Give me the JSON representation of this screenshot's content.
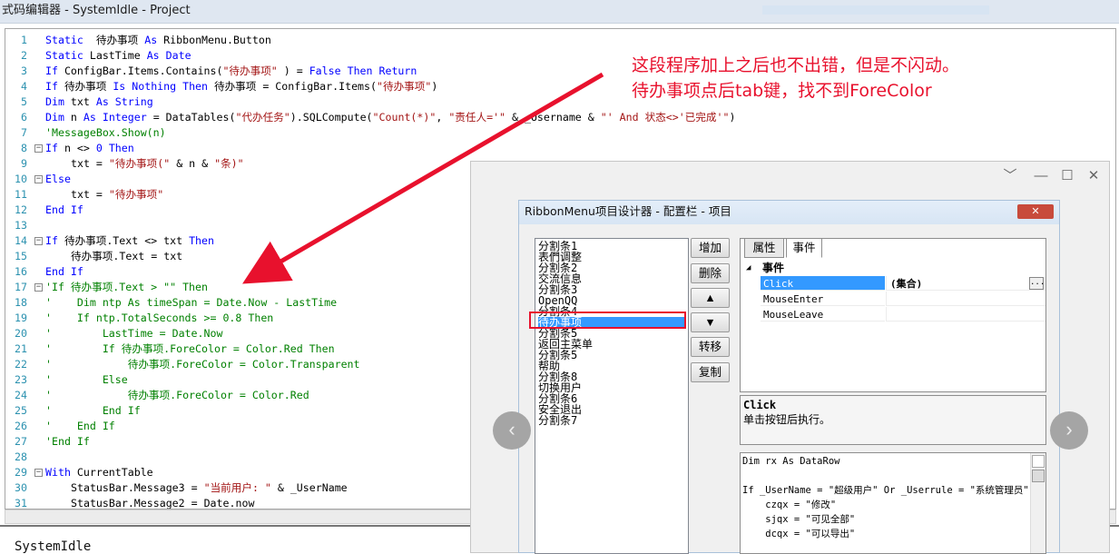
{
  "window": {
    "title": "式码编辑器 - SystemIdle - Project"
  },
  "code_lines": [
    {
      "n": "1",
      "segs": [
        [
          "kw",
          "Static"
        ],
        [
          "",
          "  待办事项 "
        ],
        [
          "kw",
          "As"
        ],
        [
          "",
          " RibbonMenu.Button"
        ]
      ]
    },
    {
      "n": "2",
      "segs": [
        [
          "kw",
          "Static"
        ],
        [
          "",
          " LastTime "
        ],
        [
          "kw",
          "As"
        ],
        [
          " kw",
          " Date"
        ]
      ]
    },
    {
      "n": "3",
      "segs": [
        [
          "kw",
          "If"
        ],
        [
          "",
          " ConfigBar.Items.Contains("
        ],
        [
          "str",
          "\"待办事项\""
        ],
        [
          "",
          " ) = "
        ],
        [
          "kw",
          "False Then Return"
        ]
      ]
    },
    {
      "n": "4",
      "segs": [
        [
          "kw",
          "If"
        ],
        [
          "",
          " 待办事项 "
        ],
        [
          "kw",
          "Is Nothing Then"
        ],
        [
          "",
          " 待办事项 = ConfigBar.Items("
        ],
        [
          "str",
          "\"待办事项\""
        ],
        [
          "",
          ")"
        ]
      ]
    },
    {
      "n": "5",
      "segs": [
        [
          "kw",
          "Dim"
        ],
        [
          "",
          " txt "
        ],
        [
          "kw",
          "As String"
        ]
      ]
    },
    {
      "n": "6",
      "segs": [
        [
          "kw",
          "Dim"
        ],
        [
          "",
          " n "
        ],
        [
          "kw",
          "As Integer"
        ],
        [
          "",
          " = DataTables("
        ],
        [
          "str",
          "\"代办任务\""
        ],
        [
          "",
          ").SQLCompute("
        ],
        [
          "str",
          "\"Count(*)\""
        ],
        [
          "",
          ", "
        ],
        [
          "str",
          "\"责任人='\""
        ],
        [
          "",
          " & _Username & "
        ],
        [
          "str",
          "\"' And 状态<>'已完成'\""
        ],
        [
          "",
          ")"
        ]
      ]
    },
    {
      "n": "7",
      "segs": [
        [
          "cm",
          "'MessageBox.Show(n)"
        ]
      ]
    },
    {
      "n": "8",
      "fold": "−",
      "segs": [
        [
          "kw",
          "If"
        ],
        [
          "",
          " n <> "
        ],
        [
          "kw",
          "0"
        ],
        [
          " kw",
          " Then"
        ]
      ]
    },
    {
      "n": "9",
      "indent": 2,
      "segs": [
        [
          "",
          "txt = "
        ],
        [
          "str",
          "\"待办事项(\""
        ],
        [
          "",
          " & n & "
        ],
        [
          "str",
          "\"条)\""
        ]
      ]
    },
    {
      "n": "10",
      "fold": "−",
      "segs": [
        [
          "kw",
          "Else"
        ]
      ]
    },
    {
      "n": "11",
      "indent": 2,
      "segs": [
        [
          "",
          "txt = "
        ],
        [
          "str",
          "\"待办事项\""
        ]
      ]
    },
    {
      "n": "12",
      "segs": [
        [
          "kw",
          "End If"
        ]
      ]
    },
    {
      "n": "13",
      "segs": []
    },
    {
      "n": "14",
      "fold": "−",
      "segs": [
        [
          "kw",
          "If"
        ],
        [
          "",
          " 待办事项.Text <> txt "
        ],
        [
          "kw",
          "Then"
        ]
      ]
    },
    {
      "n": "15",
      "indent": 2,
      "segs": [
        [
          "",
          "待办事项.Text = txt"
        ]
      ]
    },
    {
      "n": "16",
      "segs": [
        [
          "kw",
          "End If"
        ]
      ]
    },
    {
      "n": "17",
      "fold": "−",
      "segs": [
        [
          "cm",
          "'If 待办事项.Text > \"\" Then"
        ]
      ]
    },
    {
      "n": "18",
      "segs": [
        [
          "cm",
          "'    Dim ntp As timeSpan = Date.Now - LastTime"
        ]
      ]
    },
    {
      "n": "19",
      "segs": [
        [
          "cm",
          "'    If ntp.TotalSeconds >= 0.8 Then"
        ]
      ]
    },
    {
      "n": "20",
      "segs": [
        [
          "cm",
          "'        LastTime = Date.Now"
        ]
      ]
    },
    {
      "n": "21",
      "segs": [
        [
          "cm",
          "'        If 待办事项.ForeColor = Color.Red Then"
        ]
      ]
    },
    {
      "n": "22",
      "segs": [
        [
          "cm",
          "'            待办事项.ForeColor = Color.Transparent"
        ]
      ]
    },
    {
      "n": "23",
      "segs": [
        [
          "cm",
          "'        Else"
        ]
      ]
    },
    {
      "n": "24",
      "segs": [
        [
          "cm",
          "'            待办事项.ForeColor = Color.Red"
        ]
      ]
    },
    {
      "n": "25",
      "segs": [
        [
          "cm",
          "'        End If"
        ]
      ]
    },
    {
      "n": "26",
      "segs": [
        [
          "cm",
          "'    End If"
        ]
      ]
    },
    {
      "n": "27",
      "segs": [
        [
          "cm",
          "'End If"
        ]
      ]
    },
    {
      "n": "28",
      "segs": []
    },
    {
      "n": "29",
      "fold": "−",
      "segs": [
        [
          "kw",
          "With"
        ],
        [
          "",
          " CurrentTable"
        ]
      ]
    },
    {
      "n": "30",
      "indent": 2,
      "segs": [
        [
          "",
          "StatusBar.Message3 = "
        ],
        [
          "str",
          "\"当前用户: \""
        ],
        [
          "",
          " & _UserName"
        ]
      ]
    },
    {
      "n": "31",
      "indent": 2,
      "segs": [
        [
          "",
          "StatusBar.Message2 = Date.now"
        ]
      ]
    }
  ],
  "bottom_text": "SystemIdle",
  "annotation": {
    "line1": "这段程序加上之后也不出错，但是不闪动。",
    "line2": "待办事项点后tab键，找不到ForeColor",
    "color": "#e8112d"
  },
  "viewer": {
    "minimize": "﹀",
    "restore": "—",
    "maximize": "☐",
    "close": "✕",
    "prev": "‹",
    "next": "›"
  },
  "dialog": {
    "title": "RibbonMenu项目设计器 - 配置栏 - 项目",
    "close_label": "✕",
    "items": [
      "分割条1",
      "表們调整",
      "分割条2",
      "交流信息",
      "分割条3",
      "OpenQQ",
      "分割条4",
      "待办事项",
      "分割条5",
      "返回主菜单",
      "分割条5",
      "帮助",
      "分割条8",
      "切换用户",
      "分割条6",
      "安全退出",
      "分割条7"
    ],
    "selected_index": 7,
    "buttons": [
      "增加",
      "删除",
      "▲",
      "▼",
      "转移",
      "复制"
    ],
    "tabs": [
      "属性",
      "事件"
    ],
    "active_tab": "事件",
    "category": "事件",
    "events": [
      {
        "name": "Click",
        "value": "(集合)",
        "selected": true
      },
      {
        "name": "MouseEnter",
        "value": ""
      },
      {
        "name": "MouseLeave",
        "value": ""
      }
    ],
    "ellipsis": "...",
    "desc_title": "Click",
    "desc_text": "单击按钮后执行。",
    "code": [
      "Dim rx As DataRow",
      "",
      "If _UserName = \"超级用户\" Or _Userrule = \"系统管理员\"",
      "    czqx = \"修改\"",
      "    sjqx = \"可见全部\"",
      "    dcqx = \"可以导出\""
    ]
  }
}
